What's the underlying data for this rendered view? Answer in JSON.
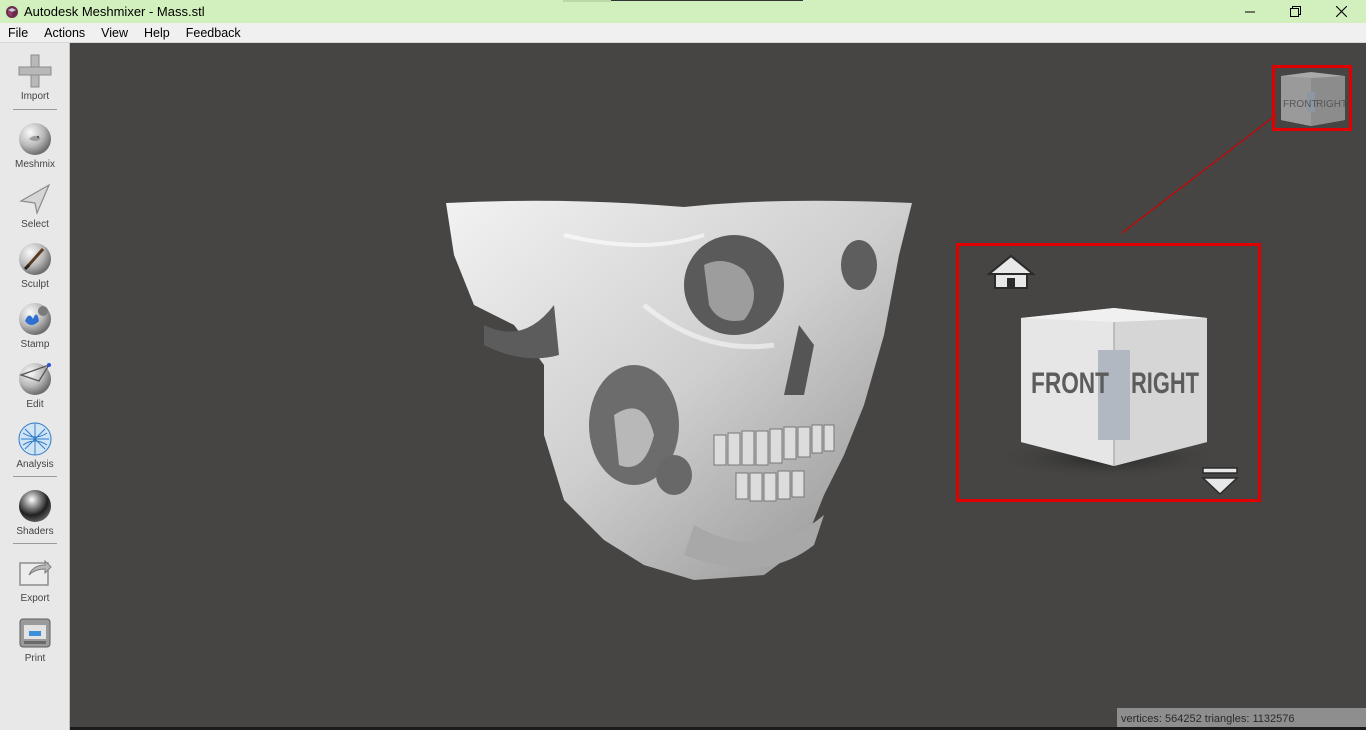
{
  "window": {
    "title": "Autodesk Meshmixer - Mass.stl",
    "minimize_icon": "minimize-icon",
    "restore_icon": "restore-icon",
    "close_icon": "close-icon"
  },
  "menu": [
    "File",
    "Actions",
    "View",
    "Help",
    "Feedback"
  ],
  "toolbar": {
    "import": "Import",
    "meshmix": "Meshmix",
    "select": "Select",
    "sculpt": "Sculpt",
    "stamp": "Stamp",
    "edit": "Edit",
    "analysis": "Analysis",
    "shaders": "Shaders",
    "export": "Export",
    "print": "Print"
  },
  "view_cube": {
    "front_label": "FRONT",
    "right_label": "RIGHT",
    "home_icon": "home-icon",
    "menu_icon": "triangle-down-icon"
  },
  "status": {
    "text": "vertices: 564252 triangles: 1132576"
  },
  "colors": {
    "titlebar": "#d2f0bd",
    "viewport": "#464544",
    "highlight": "#e00000"
  }
}
